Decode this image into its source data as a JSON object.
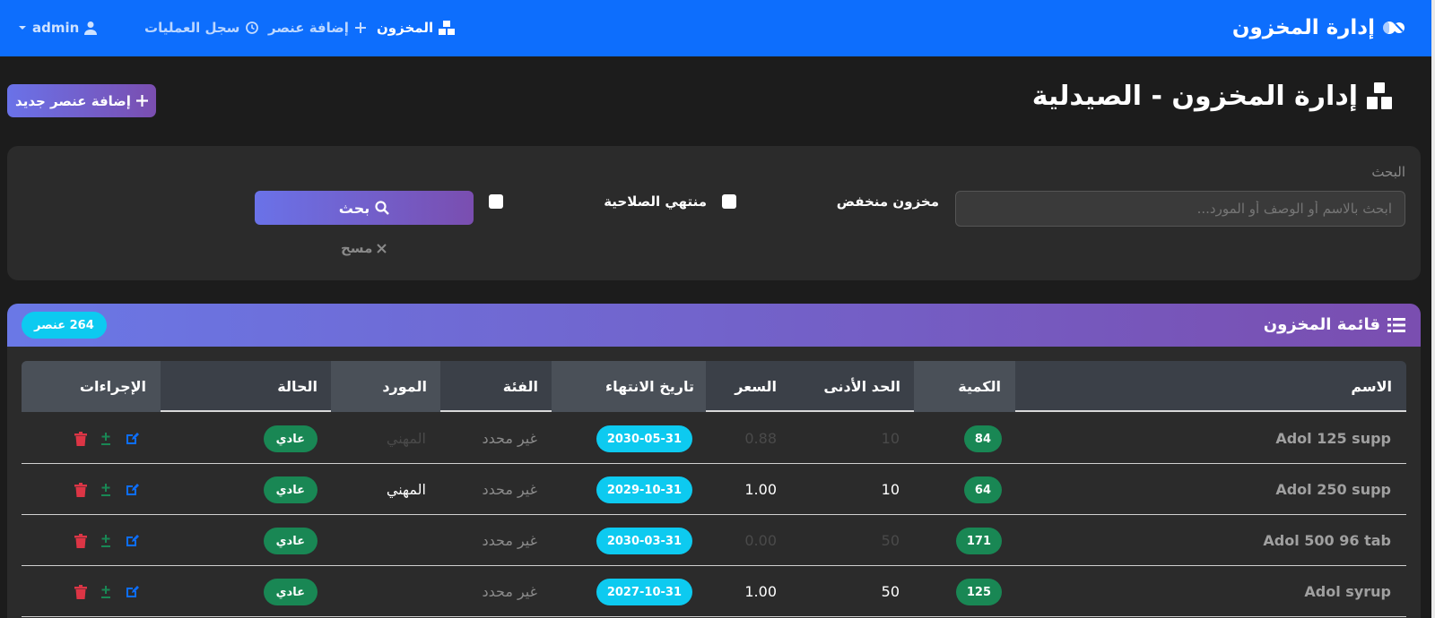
{
  "navbar": {
    "brand": "إدارة المخزون",
    "links": [
      {
        "label": "المخزون",
        "icon": "boxes-icon",
        "active": true
      },
      {
        "label": "إضافة عنصر",
        "icon": "plus-icon",
        "active": false
      },
      {
        "label": "سجل العمليات",
        "icon": "history-icon",
        "active": false
      }
    ],
    "user": "admin"
  },
  "page": {
    "title": "إدارة المخزون - الصيدلية",
    "add_button": "إضافة عنصر جديد"
  },
  "filters": {
    "search_label": "البحث",
    "search_placeholder": "ابحث بالاسم أو الوصف أو المورد...",
    "low_stock_label": "مخزون منخفض",
    "expired_label": "منتهي الصلاحية",
    "search_button": "بحث",
    "clear_button": "مسح"
  },
  "inventory": {
    "title": "قائمة المخزون",
    "count_badge": "264 عنصر",
    "columns": [
      "الاسم",
      "الكمية",
      "الحد الأدنى",
      "السعر",
      "تاريخ الانتهاء",
      "الفئة",
      "المورد",
      "الحالة",
      "الإجراءات"
    ],
    "rows": [
      {
        "name": "Adol 125 supp",
        "quantity": "84",
        "min": "10",
        "price": "0.88",
        "expiry": "2030-05-31",
        "category": "غير محدد",
        "supplier": "المهني",
        "status": "عادي"
      },
      {
        "name": "Adol 250 supp",
        "quantity": "64",
        "min": "10",
        "price": "1.00",
        "expiry": "2029-10-31",
        "category": "غير محدد",
        "supplier": "المهني",
        "status": "عادي"
      },
      {
        "name": "Adol 500 96 tab",
        "quantity": "171",
        "min": "50",
        "price": "0.00",
        "expiry": "2030-03-31",
        "category": "غير محدد",
        "supplier": "",
        "status": "عادي"
      },
      {
        "name": "Adol syrup",
        "quantity": "125",
        "min": "50",
        "price": "1.00",
        "expiry": "2027-10-31",
        "category": "غير محدد",
        "supplier": "",
        "status": "عادي"
      }
    ]
  },
  "colors": {
    "navbar": "#0d6efd",
    "gradient_start": "#6a72e8",
    "gradient_end": "#7a4eb0",
    "info_badge": "#0dcaf0",
    "success_badge": "#198754",
    "delete_icon": "#dc3545",
    "edit_icon": "#0d6efd"
  }
}
